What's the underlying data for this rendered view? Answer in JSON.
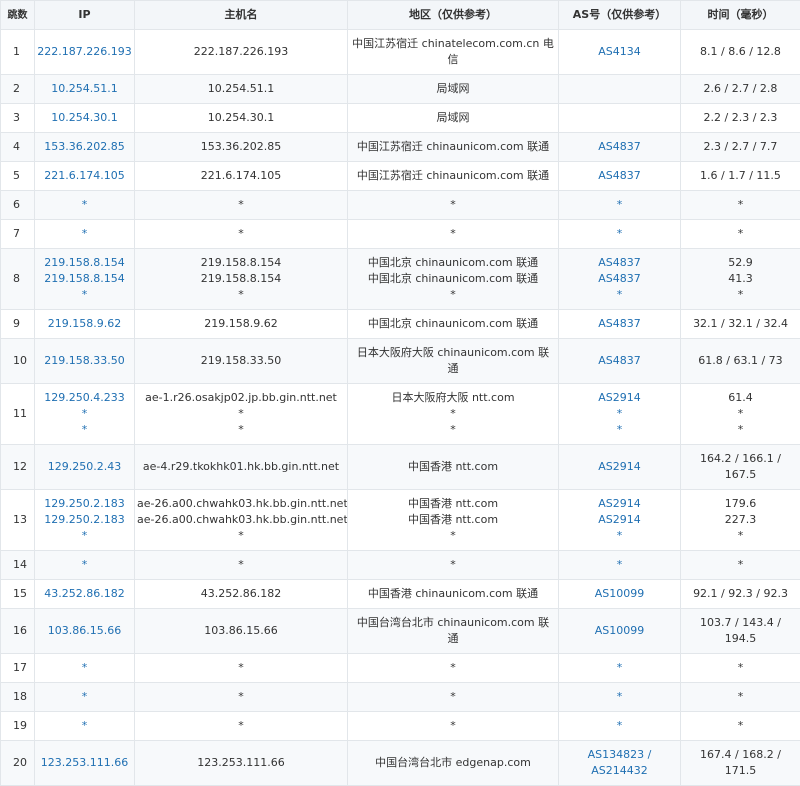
{
  "header": {
    "hop": "跳数",
    "ip": "IP",
    "host": "主机名",
    "region": "地区（仅供参考）",
    "as": "AS号（仅供参考）",
    "time": "时间（毫秒）"
  },
  "hops": [
    {
      "n": "1",
      "ip": [
        "222.187.226.193"
      ],
      "host": [
        "222.187.226.193"
      ],
      "region": [
        "中国江苏宿迁 chinatelecom.com.cn 电",
        "信"
      ],
      "as": [
        "AS4134"
      ],
      "time": [
        "8.1 / 8.6 / 12.8"
      ]
    },
    {
      "n": "2",
      "ip": [
        "10.254.51.1"
      ],
      "host": [
        "10.254.51.1"
      ],
      "region": [
        "局域网"
      ],
      "as": [
        ""
      ],
      "time": [
        "2.6 / 2.7 / 2.8"
      ]
    },
    {
      "n": "3",
      "ip": [
        "10.254.30.1"
      ],
      "host": [
        "10.254.30.1"
      ],
      "region": [
        "局域网"
      ],
      "as": [
        ""
      ],
      "time": [
        "2.2 / 2.3 / 2.3"
      ]
    },
    {
      "n": "4",
      "ip": [
        "153.36.202.85"
      ],
      "host": [
        "153.36.202.85"
      ],
      "region": [
        "中国江苏宿迁 chinaunicom.com 联通"
      ],
      "as": [
        "AS4837"
      ],
      "time": [
        "2.3 / 2.7 / 7.7"
      ]
    },
    {
      "n": "5",
      "ip": [
        "221.6.174.105"
      ],
      "host": [
        "221.6.174.105"
      ],
      "region": [
        "中国江苏宿迁 chinaunicom.com 联通"
      ],
      "as": [
        "AS4837"
      ],
      "time": [
        "1.6 / 1.7 / 11.5"
      ]
    },
    {
      "n": "6",
      "ip": [
        "*"
      ],
      "host": [
        "*"
      ],
      "region": [
        "*"
      ],
      "as": [
        "*"
      ],
      "time": [
        "*"
      ]
    },
    {
      "n": "7",
      "ip": [
        "*"
      ],
      "host": [
        "*"
      ],
      "region": [
        "*"
      ],
      "as": [
        "*"
      ],
      "time": [
        "*"
      ]
    },
    {
      "n": "8",
      "ip": [
        "219.158.8.154",
        "219.158.8.154",
        "*"
      ],
      "host": [
        "219.158.8.154",
        "219.158.8.154",
        "*"
      ],
      "region": [
        "中国北京 chinaunicom.com 联通",
        "中国北京 chinaunicom.com 联通",
        "*"
      ],
      "as": [
        "AS4837",
        "AS4837",
        "*"
      ],
      "time": [
        "52.9",
        "41.3",
        "*"
      ]
    },
    {
      "n": "9",
      "ip": [
        "219.158.9.62"
      ],
      "host": [
        "219.158.9.62"
      ],
      "region": [
        "中国北京 chinaunicom.com 联通"
      ],
      "as": [
        "AS4837"
      ],
      "time": [
        "32.1 / 32.1 / 32.4"
      ]
    },
    {
      "n": "10",
      "ip": [
        "219.158.33.50"
      ],
      "host": [
        "219.158.33.50"
      ],
      "region": [
        "日本大阪府大阪 chinaunicom.com 联",
        "通"
      ],
      "as": [
        "AS4837"
      ],
      "time": [
        "61.8 / 63.1 / 73"
      ]
    },
    {
      "n": "11",
      "ip": [
        "129.250.4.233",
        "*",
        "*"
      ],
      "host": [
        "ae-1.r26.osakjp02.jp.bb.gin.ntt.net",
        "*",
        "*"
      ],
      "region": [
        "日本大阪府大阪 ntt.com",
        "*",
        "*"
      ],
      "as": [
        "AS2914",
        "*",
        "*"
      ],
      "time": [
        "61.4",
        "*",
        "*"
      ]
    },
    {
      "n": "12",
      "ip": [
        "129.250.2.43"
      ],
      "host": [
        "ae-4.r29.tkokhk01.hk.bb.gin.ntt.net"
      ],
      "region": [
        "中国香港 ntt.com"
      ],
      "as": [
        "AS2914"
      ],
      "time": [
        "164.2 / 166.1 /",
        "167.5"
      ]
    },
    {
      "n": "13",
      "ip": [
        "129.250.2.183",
        "129.250.2.183",
        "*"
      ],
      "host": [
        "ae-26.a00.chwahk03.hk.bb.gin.ntt.net",
        "ae-26.a00.chwahk03.hk.bb.gin.ntt.net",
        "*"
      ],
      "region": [
        "中国香港 ntt.com",
        "中国香港 ntt.com",
        "*"
      ],
      "as": [
        "AS2914",
        "AS2914",
        "*"
      ],
      "time": [
        "179.6",
        "227.3",
        "*"
      ]
    },
    {
      "n": "14",
      "ip": [
        "*"
      ],
      "host": [
        "*"
      ],
      "region": [
        "*"
      ],
      "as": [
        "*"
      ],
      "time": [
        "*"
      ]
    },
    {
      "n": "15",
      "ip": [
        "43.252.86.182"
      ],
      "host": [
        "43.252.86.182"
      ],
      "region": [
        "中国香港 chinaunicom.com 联通"
      ],
      "as": [
        "AS10099"
      ],
      "time": [
        "92.1 / 92.3 / 92.3"
      ]
    },
    {
      "n": "16",
      "ip": [
        "103.86.15.66"
      ],
      "host": [
        "103.86.15.66"
      ],
      "region": [
        "中国台湾台北市 chinaunicom.com 联",
        "通"
      ],
      "as": [
        "AS10099"
      ],
      "time": [
        "103.7 / 143.4 /",
        "194.5"
      ]
    },
    {
      "n": "17",
      "ip": [
        "*"
      ],
      "host": [
        "*"
      ],
      "region": [
        "*"
      ],
      "as": [
        "*"
      ],
      "time": [
        "*"
      ]
    },
    {
      "n": "18",
      "ip": [
        "*"
      ],
      "host": [
        "*"
      ],
      "region": [
        "*"
      ],
      "as": [
        "*"
      ],
      "time": [
        "*"
      ]
    },
    {
      "n": "19",
      "ip": [
        "*"
      ],
      "host": [
        "*"
      ],
      "region": [
        "*"
      ],
      "as": [
        "*"
      ],
      "time": [
        "*"
      ]
    },
    {
      "n": "20",
      "ip": [
        "123.253.111.66"
      ],
      "host": [
        "123.253.111.66"
      ],
      "region": [
        "中国台湾台北市 edgenap.com"
      ],
      "as": [
        "AS134823 /",
        "AS214432"
      ],
      "time": [
        "167.4 / 168.2 /",
        "171.5"
      ]
    }
  ]
}
